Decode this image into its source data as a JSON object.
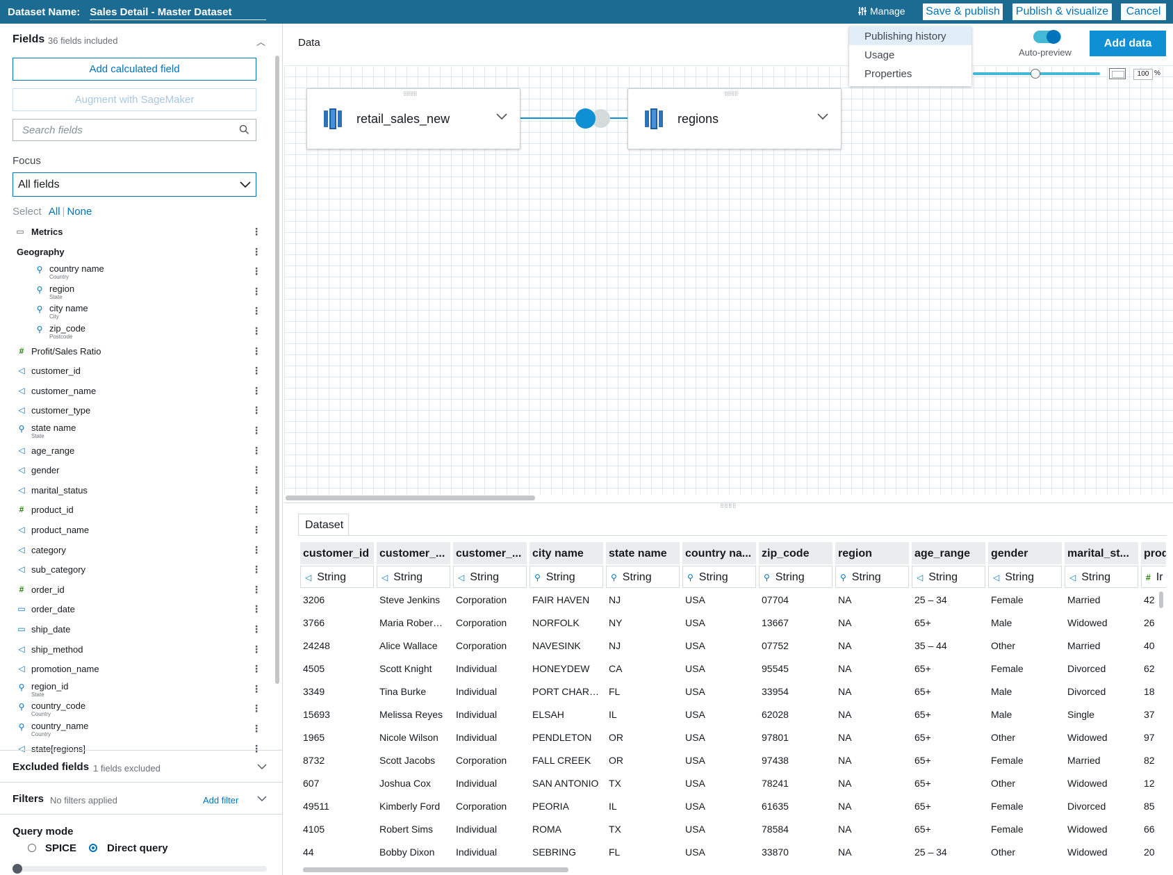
{
  "header": {
    "dataset_label": "Dataset Name:",
    "dataset_name": "Sales Detail - Master Dataset",
    "manage": "Manage",
    "save_publish": "Save & publish",
    "publish_visualize": "Publish & visualize",
    "cancel": "Cancel"
  },
  "manage_menu": [
    "Publishing history",
    "Usage",
    "Properties"
  ],
  "fields_panel": {
    "title": "Fields",
    "count": "36 fields included",
    "add_calculated": "Add calculated field",
    "augment": "Augment with SageMaker",
    "search_placeholder": "Search fields",
    "focus_label": "Focus",
    "focus_value": "All fields",
    "select_label": "Select",
    "select_all": "All",
    "select_none": "None",
    "fields": [
      {
        "name": "Metrics",
        "type": "folder"
      },
      {
        "name": "Geography",
        "type": "group"
      },
      {
        "name": "country name",
        "sub": "Country",
        "type": "geo",
        "indent": true
      },
      {
        "name": "region",
        "sub": "State",
        "type": "geo",
        "indent": true
      },
      {
        "name": "city name",
        "sub": "City",
        "type": "geo",
        "indent": true
      },
      {
        "name": "zip_code",
        "sub": "Postcode",
        "type": "geo",
        "indent": true
      },
      {
        "name": "Profit/Sales Ratio",
        "type": "measure"
      },
      {
        "name": "customer_id",
        "type": "dim"
      },
      {
        "name": "customer_name",
        "type": "dim"
      },
      {
        "name": "customer_type",
        "type": "dim"
      },
      {
        "name": "state name",
        "sub": "State",
        "type": "geo"
      },
      {
        "name": "age_range",
        "type": "dim"
      },
      {
        "name": "gender",
        "type": "dim"
      },
      {
        "name": "marital_status",
        "type": "dim"
      },
      {
        "name": "product_id",
        "type": "measure"
      },
      {
        "name": "product_name",
        "type": "dim"
      },
      {
        "name": "category",
        "type": "dim"
      },
      {
        "name": "sub_category",
        "type": "dim"
      },
      {
        "name": "order_id",
        "type": "measure"
      },
      {
        "name": "order_date",
        "type": "date"
      },
      {
        "name": "ship_date",
        "type": "date"
      },
      {
        "name": "ship_method",
        "type": "dim"
      },
      {
        "name": "promotion_name",
        "type": "dim"
      },
      {
        "name": "region_id",
        "sub": "State",
        "type": "geo"
      },
      {
        "name": "country_code",
        "sub": "Country",
        "type": "geo"
      },
      {
        "name": "country_name",
        "sub": "Country",
        "type": "geo"
      },
      {
        "name": "state[regions]",
        "type": "dim"
      }
    ]
  },
  "excluded": {
    "title": "Excluded fields",
    "sub": "1 fields excluded"
  },
  "filters": {
    "title": "Filters",
    "sub": "No filters applied",
    "add": "Add filter"
  },
  "query_mode": {
    "title": "Query mode",
    "spice": "SPICE",
    "direct": "Direct query",
    "selected": "Direct query"
  },
  "data_area": {
    "title": "Data",
    "auto_preview": "Auto-preview",
    "add_data": "Add data",
    "zoom": "100",
    "zoom_unit": "%",
    "nodes": [
      "retail_sales_new",
      "regions"
    ]
  },
  "dataset": {
    "tab": "Dataset",
    "columns": [
      {
        "header": "customer_id",
        "type": "String",
        "kind": "dim"
      },
      {
        "header": "customer_...",
        "type": "String",
        "kind": "dim"
      },
      {
        "header": "customer_...",
        "type": "String",
        "kind": "dim"
      },
      {
        "header": "city name",
        "type": "String",
        "kind": "geo"
      },
      {
        "header": "state name",
        "type": "String",
        "kind": "geo"
      },
      {
        "header": "country na...",
        "type": "String",
        "kind": "geo"
      },
      {
        "header": "zip_code",
        "type": "String",
        "kind": "geo"
      },
      {
        "header": "region",
        "type": "String",
        "kind": "geo"
      },
      {
        "header": "age_range",
        "type": "String",
        "kind": "dim"
      },
      {
        "header": "gender",
        "type": "String",
        "kind": "dim"
      },
      {
        "header": "marital_st...",
        "type": "String",
        "kind": "dim"
      },
      {
        "header": "prod",
        "type": "Ir",
        "kind": "measure"
      }
    ],
    "rows": [
      [
        "3206",
        "Steve Jenkins",
        "Corporation",
        "FAIR HAVEN",
        "NJ",
        "USA",
        "07704",
        "NA",
        "25 – 34",
        "Female",
        "Married",
        "42"
      ],
      [
        "3766",
        "Maria Rober…",
        "Corporation",
        "NORFOLK",
        "NY",
        "USA",
        "13667",
        "NA",
        "65+",
        "Male",
        "Widowed",
        "26"
      ],
      [
        "24248",
        "Alice Wallace",
        "Corporation",
        "NAVESINK",
        "NJ",
        "USA",
        "07752",
        "NA",
        "35 – 44",
        "Other",
        "Married",
        "40"
      ],
      [
        "4505",
        "Scott Knight",
        "Individual",
        "HONEYDEW",
        "CA",
        "USA",
        "95545",
        "NA",
        "65+",
        "Female",
        "Divorced",
        "62"
      ],
      [
        "3349",
        "Tina Burke",
        "Individual",
        "PORT CHAR…",
        "FL",
        "USA",
        "33954",
        "NA",
        "65+",
        "Male",
        "Divorced",
        "18"
      ],
      [
        "15693",
        "Melissa Reyes",
        "Individual",
        "ELSAH",
        "IL",
        "USA",
        "62028",
        "NA",
        "65+",
        "Male",
        "Single",
        "37"
      ],
      [
        "1965",
        "Nicole Wilson",
        "Individual",
        "PENDLETON",
        "OR",
        "USA",
        "97801",
        "NA",
        "65+",
        "Other",
        "Widowed",
        "97"
      ],
      [
        "8732",
        "Scott Jacobs",
        "Corporation",
        "FALL CREEK",
        "OR",
        "USA",
        "97438",
        "NA",
        "65+",
        "Female",
        "Married",
        "82"
      ],
      [
        "607",
        "Joshua Cox",
        "Individual",
        "SAN ANTONIO",
        "TX",
        "USA",
        "78241",
        "NA",
        "65+",
        "Other",
        "Widowed",
        "12"
      ],
      [
        "49511",
        "Kimberly Ford",
        "Corporation",
        "PEORIA",
        "IL",
        "USA",
        "61635",
        "NA",
        "65+",
        "Female",
        "Divorced",
        "85"
      ],
      [
        "4105",
        "Robert Sims",
        "Individual",
        "ROMA",
        "TX",
        "USA",
        "78584",
        "NA",
        "65+",
        "Female",
        "Widowed",
        "66"
      ],
      [
        "44",
        "Bobby Dixon",
        "Individual",
        "SEBRING",
        "FL",
        "USA",
        "33870",
        "NA",
        "25 – 34",
        "Other",
        "Widowed",
        "20"
      ]
    ]
  },
  "colors": {
    "topbar": "#1b6b93",
    "accent": "#0073bb",
    "primary_button": "#0f8fd4",
    "measure": "#1d8102"
  }
}
